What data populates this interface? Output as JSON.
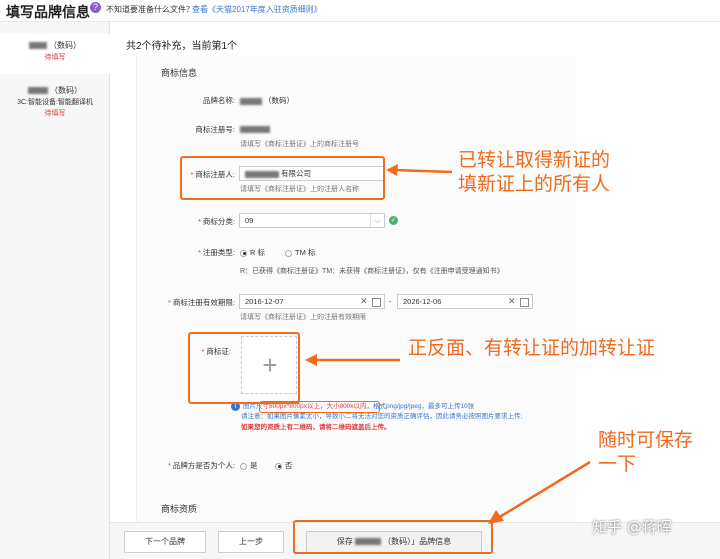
{
  "header": {
    "title": "填写品牌信息",
    "help_question": "不知道要准备什么文件？",
    "help_link": "查看《天猫2017年度入驻资质细则》"
  },
  "sidebar": {
    "items": [
      {
        "name": "（数码）",
        "status": "待填写"
      },
      {
        "name": "（数码）",
        "category": "3C:智能设备:智能翻译机",
        "status": "待填写"
      }
    ]
  },
  "main": {
    "count_text": "共2个待补充，当前第1个",
    "section_trademark": "商标信息",
    "brand_name_label": "品牌名称:",
    "brand_name_value": "（数码）",
    "reg_no_label": "商标注册号:",
    "reg_no_hint": "请填写《商标注册证》上的商标注册号",
    "registrant_label": "商标注册人:",
    "registrant_value": "有限公司",
    "registrant_hint": "请填写《商标注册证》上的注册人名称",
    "class_label": "商标分类:",
    "class_value": "09",
    "reg_type_label": "注册类型:",
    "reg_type_options": [
      "R 标",
      "TM 标"
    ],
    "reg_type_note": "R：已获得《商标注册证》TM：未获得《商标注册证》，仅有《注册申请受理通知书》",
    "validity_label": "商标注册有效期限:",
    "validity_start": "2016-12-07",
    "validity_sep": "-",
    "validity_end": "2026-12-06",
    "validity_hint": "请填写《商标注册证》上的注册有效期限",
    "cert_label": "商标证:",
    "img_tip_prefix": "图片尺",
    "img_tip_box": "寸800px*800px以上，大小800k以内",
    "img_tip_suffix": "，格式png/jpg/jpeg，最多可上传10张",
    "img_tip_line2": "请注意：如果图片像素太小，导致小二将无法对您的资质正确评估，因此请务必按照图片要求上传;",
    "img_tip_line3": "如果您的资质上有二维码，请将二维码遮盖后上传。",
    "personal_label": "品牌方是否为个人:",
    "personal_options": [
      "是",
      "否"
    ],
    "section_qualification": "商标资质"
  },
  "annotations": {
    "a1_line1": "已转让取得新证的",
    "a1_line2": "填新证上的所有人",
    "a2": "正反面、有转让证的加转让证",
    "a3_line1": "随时可保存",
    "a3_line2": "一下"
  },
  "footer": {
    "next_label": "下一个品牌",
    "prev_label": "上一步",
    "save_prefix": "保存",
    "save_suffix": "（数码）」品牌信息"
  },
  "watermark": "知乎 @蒋晖",
  "colors": {
    "accent": "#f06a1f",
    "required": "#e4393c",
    "link": "#3a76c8"
  }
}
